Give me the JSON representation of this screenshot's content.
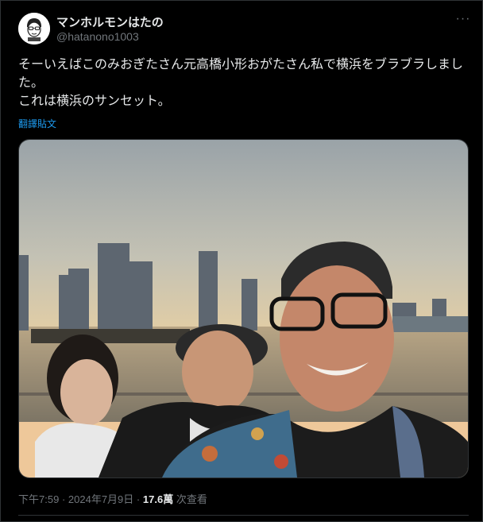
{
  "author": {
    "display_name": "マンホルモンはたの",
    "handle": "@hatanono1003",
    "avatar_icon": "avatar-face-illustration"
  },
  "menu": {
    "more_label": "···",
    "icon": "more-horizontal-icon"
  },
  "post": {
    "text": "そーいえばこのみおぎたさん元高橋小形おがたさん私で横浜をブラブラしました。\nこれは横浜のサンセット。",
    "translate_label": "翻譯貼文"
  },
  "meta": {
    "time": "下午7:59",
    "separator": "·",
    "date": "2024年7月9日",
    "views_count": "17.6萬",
    "views_label": "次查看"
  },
  "colors": {
    "background": "#000000",
    "text": "#e7e9ea",
    "muted": "#71767b",
    "link": "#1d9bf0",
    "border": "#2f3336"
  }
}
